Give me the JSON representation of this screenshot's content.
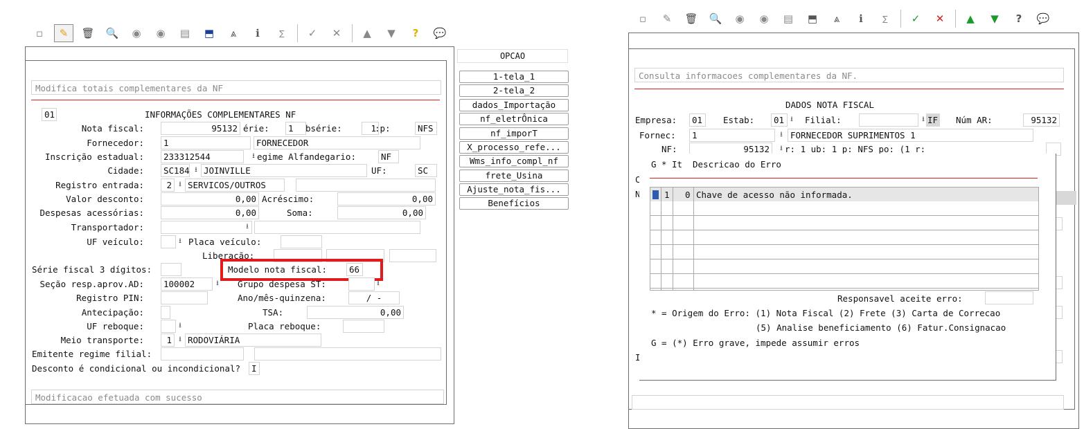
{
  "left": {
    "toolbar_icons": [
      "new-icon",
      "edit-icon",
      "delete-icon",
      "search-icon",
      "prev-icon",
      "next-icon",
      "print-icon",
      "import-icon",
      "binoculars-icon",
      "info-icon",
      "sum-icon",
      "confirm-icon",
      "cancel-icon",
      "up-icon",
      "down-icon",
      "help-icon",
      "chat-icon"
    ],
    "header_msg": "Modifica totais complementares da NF",
    "code": "01",
    "title": "INFORMAÇÕES COMPLEMENTARES NF",
    "labels": {
      "nota_fiscal": "Nota fiscal:",
      "serie": "érie:",
      "subserie": "bsérie:",
      "tp": ":p:",
      "fornecedor": "Fornecedor:",
      "inscricao": "Inscrição estadual:",
      "regime": "egime Alfandegario:",
      "cidade": "Cidade:",
      "uf": "UF:",
      "registro_entrada": "Registro entrada:",
      "valor_desconto": "Valor desconto:",
      "acrescimo": "Acréscimo:",
      "despesas": "Despesas acessórias:",
      "soma": "Soma:",
      "transportador": "Transportador:",
      "uf_veiculo": "UF veículo:",
      "placa_veiculo": "Placa veículo:",
      "liberacao": "Liberação:",
      "serie_fiscal": "Série fiscal 3 dígitos:",
      "modelo_nf": "Modelo nota fiscal:",
      "secao": "Seção resp.aprov.AD:",
      "grupo_despesa": "Grupo despesa ST:",
      "registro_pin": "Registro PIN:",
      "ano_mes": "Ano/mês-quinzena:",
      "antecipacao": "Antecipação:",
      "tsa": "TSA:",
      "uf_reboque": "UF reboque:",
      "placa_reboque": "Placa reboque:",
      "meio_transporte": "Meio transporte:",
      "emitente": "Emitente regime filial:",
      "desconto_cond": "Desconto é condicional ou incondicional?"
    },
    "values": {
      "nota_fiscal": "95132",
      "serie": "1",
      "subserie": "1",
      "tp": "NFS",
      "fornecedor_code": "1",
      "fornecedor_name": "FORNECEDOR",
      "inscricao": "233312544",
      "regime": "NF",
      "cidade_code": "SC184",
      "cidade_name": "JOINVILLE",
      "uf": "SC",
      "registro_code": "2",
      "registro_name": "SERVICOS/OUTROS",
      "valor_desconto": "0,00",
      "acrescimo": "0,00",
      "despesas": "0,00",
      "soma": "0,00",
      "modelo_nf": "66",
      "secao": "100002",
      "ano_mes": "/ -",
      "tsa": "0,00",
      "meio_code": "1",
      "meio_name": "RODOVIÁRIA",
      "desconto_cond": "I"
    },
    "footer_msg": "Modificacao efetuada com sucesso"
  },
  "options": {
    "header": "OPCAO",
    "items": [
      "1-tela_1",
      "2-tela_2",
      "dados_Importação",
      "nf_eletrÔnica",
      "nf_imporT",
      "X_processo_refe...",
      "Wms_info_compl_nf",
      "frete_Usina",
      "Ajuste_nota_fis...",
      "Benefícios"
    ]
  },
  "right": {
    "toolbar_icons": [
      "new-icon",
      "edit-icon",
      "delete-icon",
      "search-icon",
      "prev-icon",
      "next-icon",
      "print-icon",
      "import-icon",
      "binoculars-icon",
      "info-icon",
      "sum-icon",
      "confirm-icon",
      "cancel-icon",
      "up-icon",
      "down-icon",
      "help-icon",
      "chat-icon"
    ],
    "header_msg": "Consulta informacoes complementares da NF.",
    "title": "DADOS NOTA FISCAL",
    "labels": {
      "empresa": "Empresa:",
      "estab": "Estab:",
      "filial": "Filial:",
      "num_ar": "Núm AR:",
      "fornec": "Fornec:",
      "nf": "NF:"
    },
    "values": {
      "empresa": "01",
      "estab": "01",
      "filial_suffix": "IF",
      "num_ar": "95132",
      "fornec_code": "1",
      "fornec_name": "FORNECEDOR SUPRIMENTOS 1",
      "nf_row": "95132",
      "nf_tail": "r:   1    ub:   1 p:   NFS po:   (1 r:"
    },
    "peek_left": [
      "C",
      "N",
      "I"
    ],
    "error_dialog": {
      "headers": [
        "G",
        "*",
        "It",
        "Descricao do Erro"
      ],
      "row": {
        "g": "",
        "origin": "1",
        "item": "0",
        "desc": "Chave de acesso não informada."
      },
      "resp_label": "Responsavel aceite erro:",
      "legend1": "* = Origem do Erro: (1) Nota Fiscal  (2) Frete (3) Carta de Correcao",
      "legend2": "(5) Analise beneficiamento (6) Fatur.Consignacao",
      "legend3": "G = (*) Erro grave, impede assumir erros"
    }
  }
}
